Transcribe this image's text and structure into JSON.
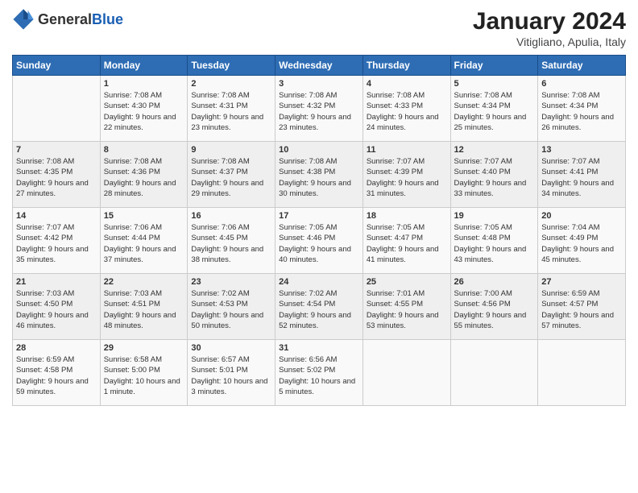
{
  "header": {
    "logo_general": "General",
    "logo_blue": "Blue",
    "month_year": "January 2024",
    "location": "Vitigliano, Apulia, Italy"
  },
  "days_of_week": [
    "Sunday",
    "Monday",
    "Tuesday",
    "Wednesday",
    "Thursday",
    "Friday",
    "Saturday"
  ],
  "weeks": [
    [
      {
        "day": "",
        "sunrise": "",
        "sunset": "",
        "daylight": ""
      },
      {
        "day": "1",
        "sunrise": "Sunrise: 7:08 AM",
        "sunset": "Sunset: 4:30 PM",
        "daylight": "Daylight: 9 hours and 22 minutes."
      },
      {
        "day": "2",
        "sunrise": "Sunrise: 7:08 AM",
        "sunset": "Sunset: 4:31 PM",
        "daylight": "Daylight: 9 hours and 23 minutes."
      },
      {
        "day": "3",
        "sunrise": "Sunrise: 7:08 AM",
        "sunset": "Sunset: 4:32 PM",
        "daylight": "Daylight: 9 hours and 23 minutes."
      },
      {
        "day": "4",
        "sunrise": "Sunrise: 7:08 AM",
        "sunset": "Sunset: 4:33 PM",
        "daylight": "Daylight: 9 hours and 24 minutes."
      },
      {
        "day": "5",
        "sunrise": "Sunrise: 7:08 AM",
        "sunset": "Sunset: 4:34 PM",
        "daylight": "Daylight: 9 hours and 25 minutes."
      },
      {
        "day": "6",
        "sunrise": "Sunrise: 7:08 AM",
        "sunset": "Sunset: 4:34 PM",
        "daylight": "Daylight: 9 hours and 26 minutes."
      }
    ],
    [
      {
        "day": "7",
        "sunrise": "Sunrise: 7:08 AM",
        "sunset": "Sunset: 4:35 PM",
        "daylight": "Daylight: 9 hours and 27 minutes."
      },
      {
        "day": "8",
        "sunrise": "Sunrise: 7:08 AM",
        "sunset": "Sunset: 4:36 PM",
        "daylight": "Daylight: 9 hours and 28 minutes."
      },
      {
        "day": "9",
        "sunrise": "Sunrise: 7:08 AM",
        "sunset": "Sunset: 4:37 PM",
        "daylight": "Daylight: 9 hours and 29 minutes."
      },
      {
        "day": "10",
        "sunrise": "Sunrise: 7:08 AM",
        "sunset": "Sunset: 4:38 PM",
        "daylight": "Daylight: 9 hours and 30 minutes."
      },
      {
        "day": "11",
        "sunrise": "Sunrise: 7:07 AM",
        "sunset": "Sunset: 4:39 PM",
        "daylight": "Daylight: 9 hours and 31 minutes."
      },
      {
        "day": "12",
        "sunrise": "Sunrise: 7:07 AM",
        "sunset": "Sunset: 4:40 PM",
        "daylight": "Daylight: 9 hours and 33 minutes."
      },
      {
        "day": "13",
        "sunrise": "Sunrise: 7:07 AM",
        "sunset": "Sunset: 4:41 PM",
        "daylight": "Daylight: 9 hours and 34 minutes."
      }
    ],
    [
      {
        "day": "14",
        "sunrise": "Sunrise: 7:07 AM",
        "sunset": "Sunset: 4:42 PM",
        "daylight": "Daylight: 9 hours and 35 minutes."
      },
      {
        "day": "15",
        "sunrise": "Sunrise: 7:06 AM",
        "sunset": "Sunset: 4:44 PM",
        "daylight": "Daylight: 9 hours and 37 minutes."
      },
      {
        "day": "16",
        "sunrise": "Sunrise: 7:06 AM",
        "sunset": "Sunset: 4:45 PM",
        "daylight": "Daylight: 9 hours and 38 minutes."
      },
      {
        "day": "17",
        "sunrise": "Sunrise: 7:05 AM",
        "sunset": "Sunset: 4:46 PM",
        "daylight": "Daylight: 9 hours and 40 minutes."
      },
      {
        "day": "18",
        "sunrise": "Sunrise: 7:05 AM",
        "sunset": "Sunset: 4:47 PM",
        "daylight": "Daylight: 9 hours and 41 minutes."
      },
      {
        "day": "19",
        "sunrise": "Sunrise: 7:05 AM",
        "sunset": "Sunset: 4:48 PM",
        "daylight": "Daylight: 9 hours and 43 minutes."
      },
      {
        "day": "20",
        "sunrise": "Sunrise: 7:04 AM",
        "sunset": "Sunset: 4:49 PM",
        "daylight": "Daylight: 9 hours and 45 minutes."
      }
    ],
    [
      {
        "day": "21",
        "sunrise": "Sunrise: 7:03 AM",
        "sunset": "Sunset: 4:50 PM",
        "daylight": "Daylight: 9 hours and 46 minutes."
      },
      {
        "day": "22",
        "sunrise": "Sunrise: 7:03 AM",
        "sunset": "Sunset: 4:51 PM",
        "daylight": "Daylight: 9 hours and 48 minutes."
      },
      {
        "day": "23",
        "sunrise": "Sunrise: 7:02 AM",
        "sunset": "Sunset: 4:53 PM",
        "daylight": "Daylight: 9 hours and 50 minutes."
      },
      {
        "day": "24",
        "sunrise": "Sunrise: 7:02 AM",
        "sunset": "Sunset: 4:54 PM",
        "daylight": "Daylight: 9 hours and 52 minutes."
      },
      {
        "day": "25",
        "sunrise": "Sunrise: 7:01 AM",
        "sunset": "Sunset: 4:55 PM",
        "daylight": "Daylight: 9 hours and 53 minutes."
      },
      {
        "day": "26",
        "sunrise": "Sunrise: 7:00 AM",
        "sunset": "Sunset: 4:56 PM",
        "daylight": "Daylight: 9 hours and 55 minutes."
      },
      {
        "day": "27",
        "sunrise": "Sunrise: 6:59 AM",
        "sunset": "Sunset: 4:57 PM",
        "daylight": "Daylight: 9 hours and 57 minutes."
      }
    ],
    [
      {
        "day": "28",
        "sunrise": "Sunrise: 6:59 AM",
        "sunset": "Sunset: 4:58 PM",
        "daylight": "Daylight: 9 hours and 59 minutes."
      },
      {
        "day": "29",
        "sunrise": "Sunrise: 6:58 AM",
        "sunset": "Sunset: 5:00 PM",
        "daylight": "Daylight: 10 hours and 1 minute."
      },
      {
        "day": "30",
        "sunrise": "Sunrise: 6:57 AM",
        "sunset": "Sunset: 5:01 PM",
        "daylight": "Daylight: 10 hours and 3 minutes."
      },
      {
        "day": "31",
        "sunrise": "Sunrise: 6:56 AM",
        "sunset": "Sunset: 5:02 PM",
        "daylight": "Daylight: 10 hours and 5 minutes."
      },
      {
        "day": "",
        "sunrise": "",
        "sunset": "",
        "daylight": ""
      },
      {
        "day": "",
        "sunrise": "",
        "sunset": "",
        "daylight": ""
      },
      {
        "day": "",
        "sunrise": "",
        "sunset": "",
        "daylight": ""
      }
    ]
  ]
}
